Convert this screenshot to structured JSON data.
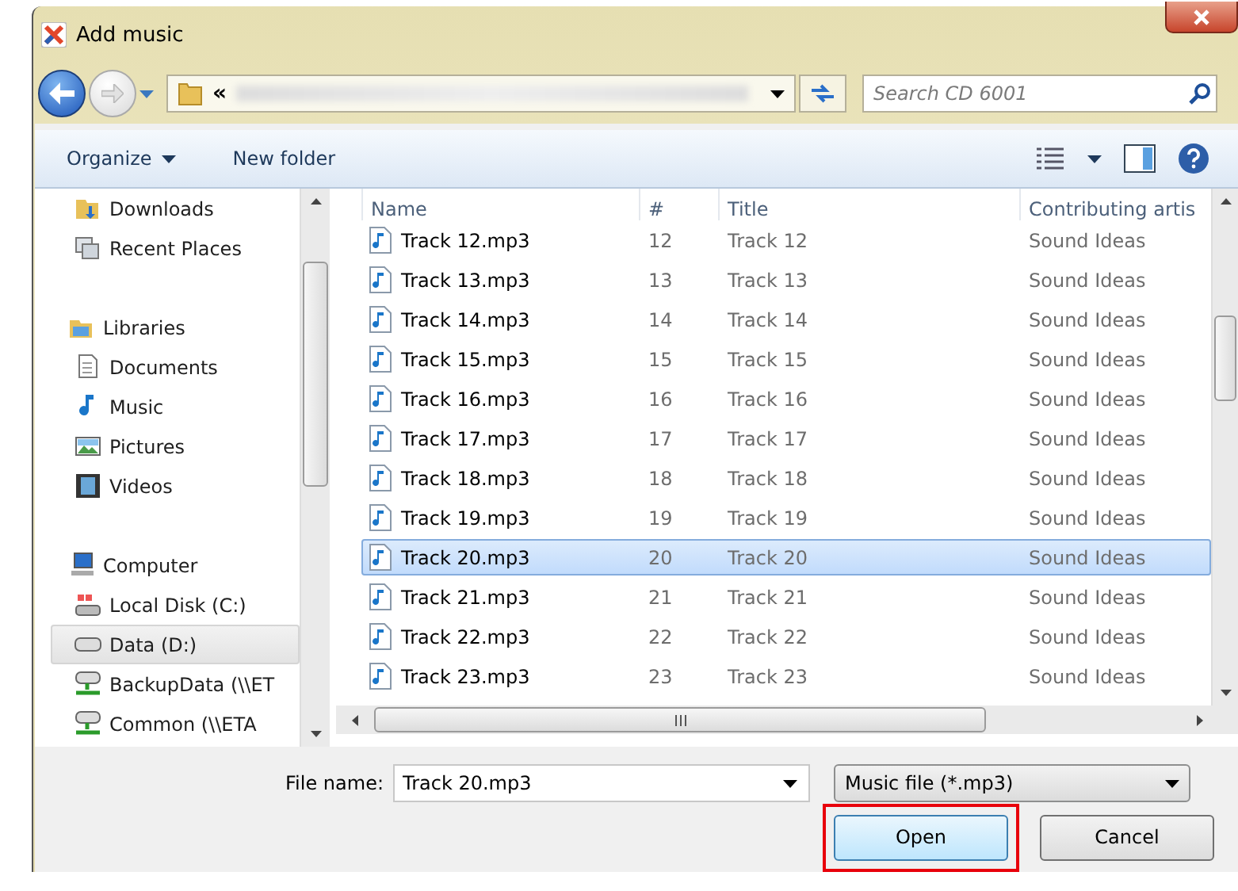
{
  "window": {
    "title": "Add music"
  },
  "address_bar": {
    "path_prefix": "«"
  },
  "search": {
    "placeholder": "Search CD 6001"
  },
  "toolbar": {
    "items": [
      "Organize",
      "New folder"
    ]
  },
  "sidebar": {
    "sections": [
      {
        "children": [
          {
            "label": "Downloads",
            "kind": "downloads",
            "selected": false
          },
          {
            "label": "Recent Places",
            "kind": "recent",
            "selected": false
          }
        ]
      },
      {
        "label": "Libraries",
        "kind": "libraries",
        "children": [
          {
            "label": "Documents",
            "kind": "documents",
            "selected": false
          },
          {
            "label": "Music",
            "kind": "music",
            "selected": false
          },
          {
            "label": "Pictures",
            "kind": "pictures",
            "selected": false
          },
          {
            "label": "Videos",
            "kind": "videos",
            "selected": false
          }
        ]
      },
      {
        "label": "Computer",
        "kind": "computer",
        "children": [
          {
            "label": "Local Disk (C:)",
            "kind": "system-disk",
            "selected": false
          },
          {
            "label": "Data (D:)",
            "kind": "disk",
            "selected": true
          },
          {
            "label": "BackupData (\\\\ET",
            "kind": "network",
            "selected": false
          },
          {
            "label": "Common (\\\\ETA",
            "kind": "network",
            "selected": false
          }
        ]
      }
    ]
  },
  "table": {
    "columns": [
      "Name",
      "#",
      "Title",
      "Contributing artis"
    ],
    "rows": [
      {
        "name": "Track 12.mp3",
        "number": "12",
        "title": "Track 12",
        "artist": "Sound Ideas",
        "selected": false
      },
      {
        "name": "Track 13.mp3",
        "number": "13",
        "title": "Track 13",
        "artist": "Sound Ideas",
        "selected": false
      },
      {
        "name": "Track 14.mp3",
        "number": "14",
        "title": "Track 14",
        "artist": "Sound Ideas",
        "selected": false
      },
      {
        "name": "Track 15.mp3",
        "number": "15",
        "title": "Track 15",
        "artist": "Sound Ideas",
        "selected": false
      },
      {
        "name": "Track 16.mp3",
        "number": "16",
        "title": "Track 16",
        "artist": "Sound Ideas",
        "selected": false
      },
      {
        "name": "Track 17.mp3",
        "number": "17",
        "title": "Track 17",
        "artist": "Sound Ideas",
        "selected": false
      },
      {
        "name": "Track 18.mp3",
        "number": "18",
        "title": "Track 18",
        "artist": "Sound Ideas",
        "selected": false
      },
      {
        "name": "Track 19.mp3",
        "number": "19",
        "title": "Track 19",
        "artist": "Sound Ideas",
        "selected": false
      },
      {
        "name": "Track 20.mp3",
        "number": "20",
        "title": "Track 20",
        "artist": "Sound Ideas",
        "selected": true
      },
      {
        "name": "Track 21.mp3",
        "number": "21",
        "title": "Track 21",
        "artist": "Sound Ideas",
        "selected": false
      },
      {
        "name": "Track 22.mp3",
        "number": "22",
        "title": "Track 22",
        "artist": "Sound Ideas",
        "selected": false
      },
      {
        "name": "Track 23.mp3",
        "number": "23",
        "title": "Track 23",
        "artist": "Sound Ideas",
        "selected": false
      }
    ]
  },
  "file_name": {
    "label": "File name:",
    "value": "Track 20.mp3"
  },
  "file_type": {
    "value": "Music file (*.mp3)"
  },
  "buttons": [
    {
      "label": "Open",
      "highlighted": true
    },
    {
      "label": "Cancel",
      "highlighted": false
    }
  ]
}
